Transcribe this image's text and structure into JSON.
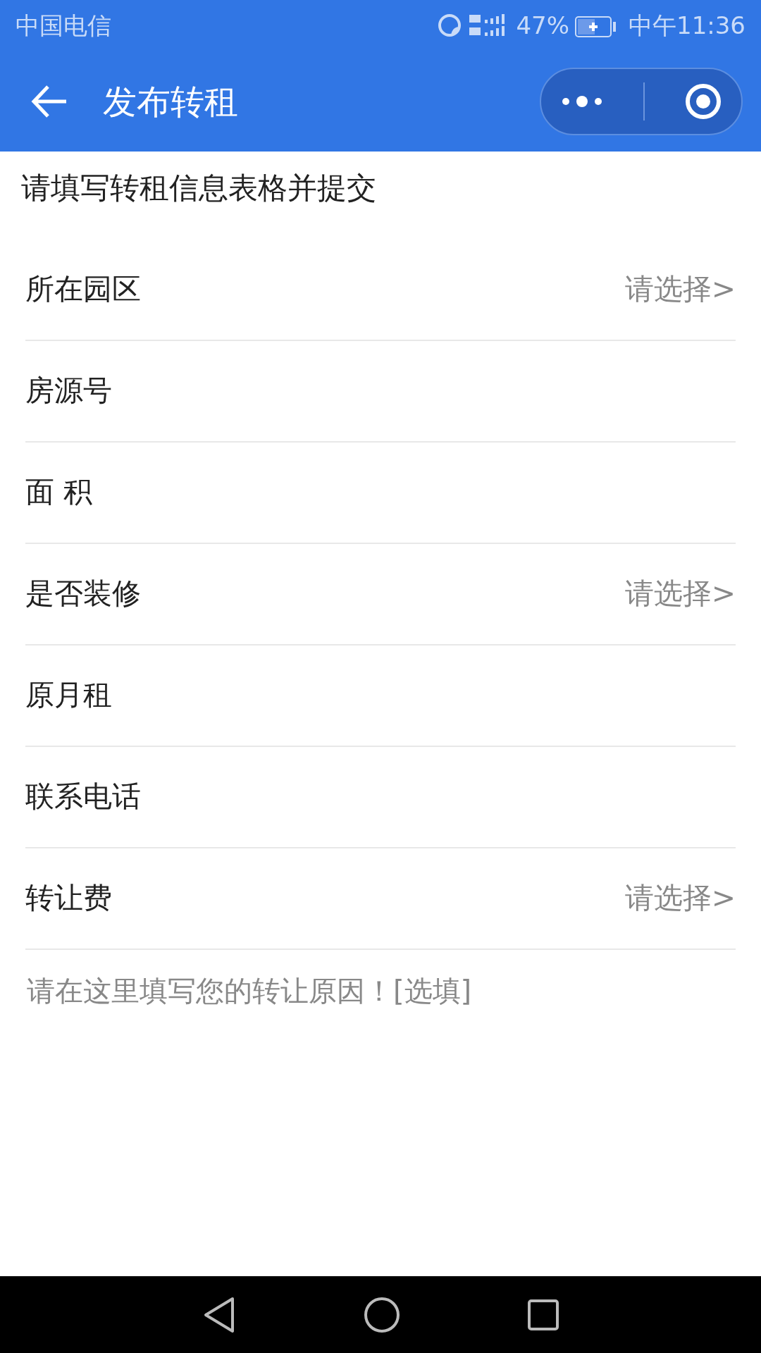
{
  "status_bar": {
    "carrier": "中国电信",
    "battery": "47%",
    "time": "中午11:36"
  },
  "header": {
    "title": "发布转租"
  },
  "intro": "请填写转租信息表格并提交",
  "rows": [
    {
      "label": "所在园区",
      "kind": "select",
      "hint": "请选择>"
    },
    {
      "label": "房源号",
      "kind": "input"
    },
    {
      "label": "面 积",
      "kind": "input"
    },
    {
      "label": "是否装修",
      "kind": "select",
      "hint": "请选择>"
    },
    {
      "label": "原月租",
      "kind": "input"
    },
    {
      "label": "联系电话",
      "kind": "input"
    },
    {
      "label": "转让费",
      "kind": "select",
      "hint": "请选择>"
    }
  ],
  "reason": {
    "placeholder": "请在这里填写您的转让原因！[选填]"
  }
}
